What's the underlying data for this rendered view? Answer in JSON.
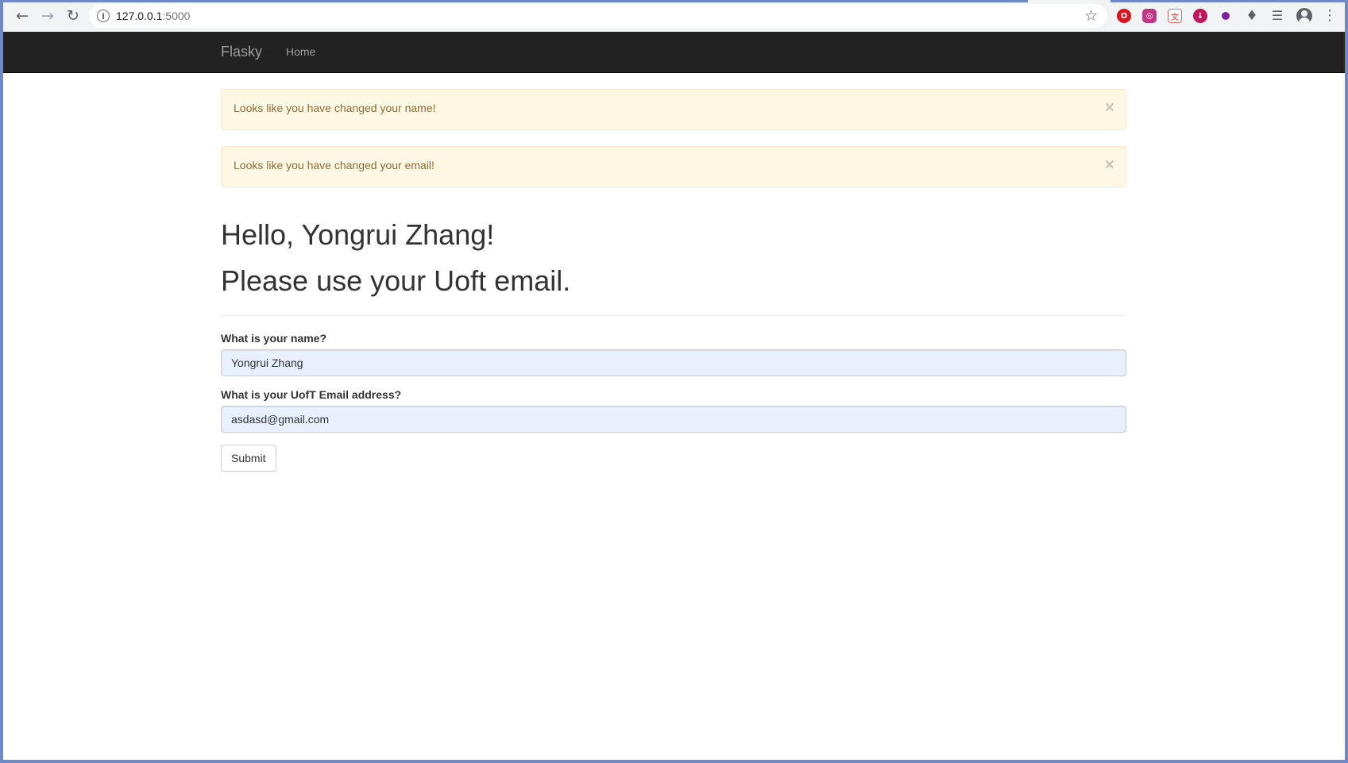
{
  "browser": {
    "url_host": "127.0.0.1",
    "url_port": ":5000",
    "nav_icons": {
      "back": "arrow-left-icon",
      "forward": "arrow-right-icon",
      "reload": "reload-icon"
    },
    "extensions": [
      {
        "name": "opera-adblock-icon",
        "color": "#e0121e"
      },
      {
        "name": "instagram-icon",
        "color": "#c13584"
      },
      {
        "name": "translate-extension-icon",
        "color": "#e26a6a"
      },
      {
        "name": "download-extension-icon",
        "color": "#c2185b"
      },
      {
        "name": "purple-extension-icon",
        "color": "#7b1fa2"
      }
    ]
  },
  "navbar": {
    "brand": "Flasky",
    "home": "Home"
  },
  "alerts": [
    {
      "message": "Looks like you have changed your name!",
      "close": "×"
    },
    {
      "message": "Looks like you have changed your email!",
      "close": "×"
    }
  ],
  "header": {
    "greeting": "Hello, Yongrui Zhang!",
    "notice": "Please use your Uoft email."
  },
  "form": {
    "name_label": "What is your name?",
    "name_value": "Yongrui Zhang",
    "email_label": "What is your UofT Email address?",
    "email_value": "asdasd@gmail.com",
    "submit_label": "Submit"
  },
  "colors": {
    "navbar_bg": "#222222",
    "alert_bg": "#fcf8e3",
    "alert_text": "#8a6d3b",
    "autofill_bg": "#e8f0fe"
  }
}
